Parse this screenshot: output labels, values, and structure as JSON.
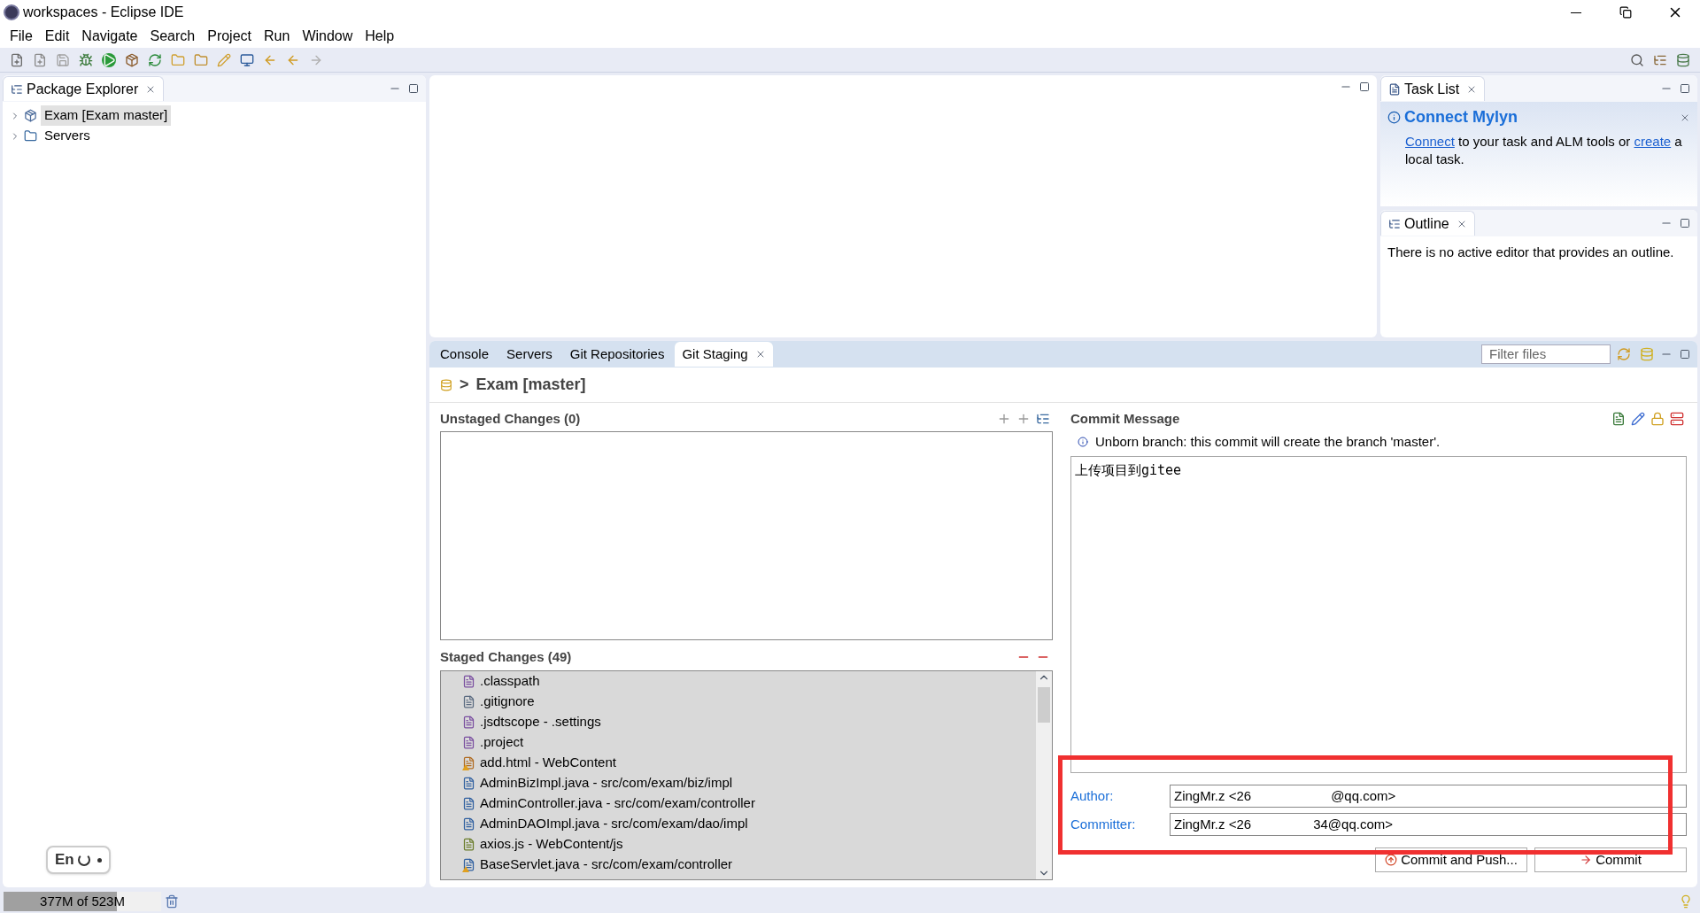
{
  "window": {
    "title": "workspaces - Eclipse IDE"
  },
  "menu": [
    "File",
    "Edit",
    "Navigate",
    "Search",
    "Project",
    "Run",
    "Window",
    "Help"
  ],
  "package_explorer": {
    "title": "Package Explorer",
    "items": [
      {
        "label": "Exam [Exam master]",
        "kind": "project",
        "selected": true
      },
      {
        "label": "Servers",
        "kind": "folder",
        "selected": false
      }
    ]
  },
  "task_list": {
    "title": "Task List",
    "mylyn_title": "Connect Mylyn",
    "link_1": "Connect",
    "text_1": " to your task and ALM tools or ",
    "link_2": "create",
    "text_2": " a local task."
  },
  "outline": {
    "title": "Outline",
    "message": "There is no active editor that provides an outline."
  },
  "bottom_tabs": [
    {
      "label": "Console",
      "selected": false
    },
    {
      "label": "Servers",
      "selected": false
    },
    {
      "label": "Git Repositories",
      "selected": false
    },
    {
      "label": "Git Staging",
      "selected": true
    }
  ],
  "filter": {
    "placeholder": "Filter files"
  },
  "staging": {
    "separator": ">",
    "repository": "Exam [master]",
    "unstaged_title": "Unstaged Changes (0)",
    "staged_title": "Staged Changes (49)",
    "files": [
      {
        "name": ".classpath",
        "kind": "xml",
        "warning": false
      },
      {
        "name": ".gitignore",
        "kind": "text",
        "warning": false
      },
      {
        "name": ".jsdtscope - .settings",
        "kind": "xml",
        "warning": false
      },
      {
        "name": ".project",
        "kind": "xml",
        "warning": false
      },
      {
        "name": "add.html - WebContent",
        "kind": "html",
        "warning": true
      },
      {
        "name": "AdminBizImpl.java - src/com/exam/biz/impl",
        "kind": "java",
        "warning": false
      },
      {
        "name": "AdminController.java - src/com/exam/controller",
        "kind": "java",
        "warning": false
      },
      {
        "name": "AdminDAOImpl.java - src/com/exam/dao/impl",
        "kind": "java",
        "warning": false
      },
      {
        "name": "axios.js - WebContent/js",
        "kind": "js",
        "warning": false
      },
      {
        "name": "BaseServlet.java - src/com/exam/controller",
        "kind": "java",
        "warning": true
      }
    ]
  },
  "commit": {
    "title": "Commit Message",
    "info": "Unborn branch: this commit will create the branch 'master'.",
    "message": "上传项目到gitee",
    "author_label": "Author:",
    "author_start": "ZingMr.z <26",
    "author_end": "@qq.com>",
    "committer_label": "Committer:",
    "committer_start": "ZingMr.z <26",
    "committer_end": "34@qq.com>"
  },
  "buttons": [
    {
      "label": "Commit and Push...",
      "kind": "push"
    },
    {
      "label": "Commit",
      "kind": "commit"
    }
  ],
  "status": {
    "heap": "377M of 523M",
    "level": 0.72
  },
  "ime": {
    "label": "En"
  }
}
